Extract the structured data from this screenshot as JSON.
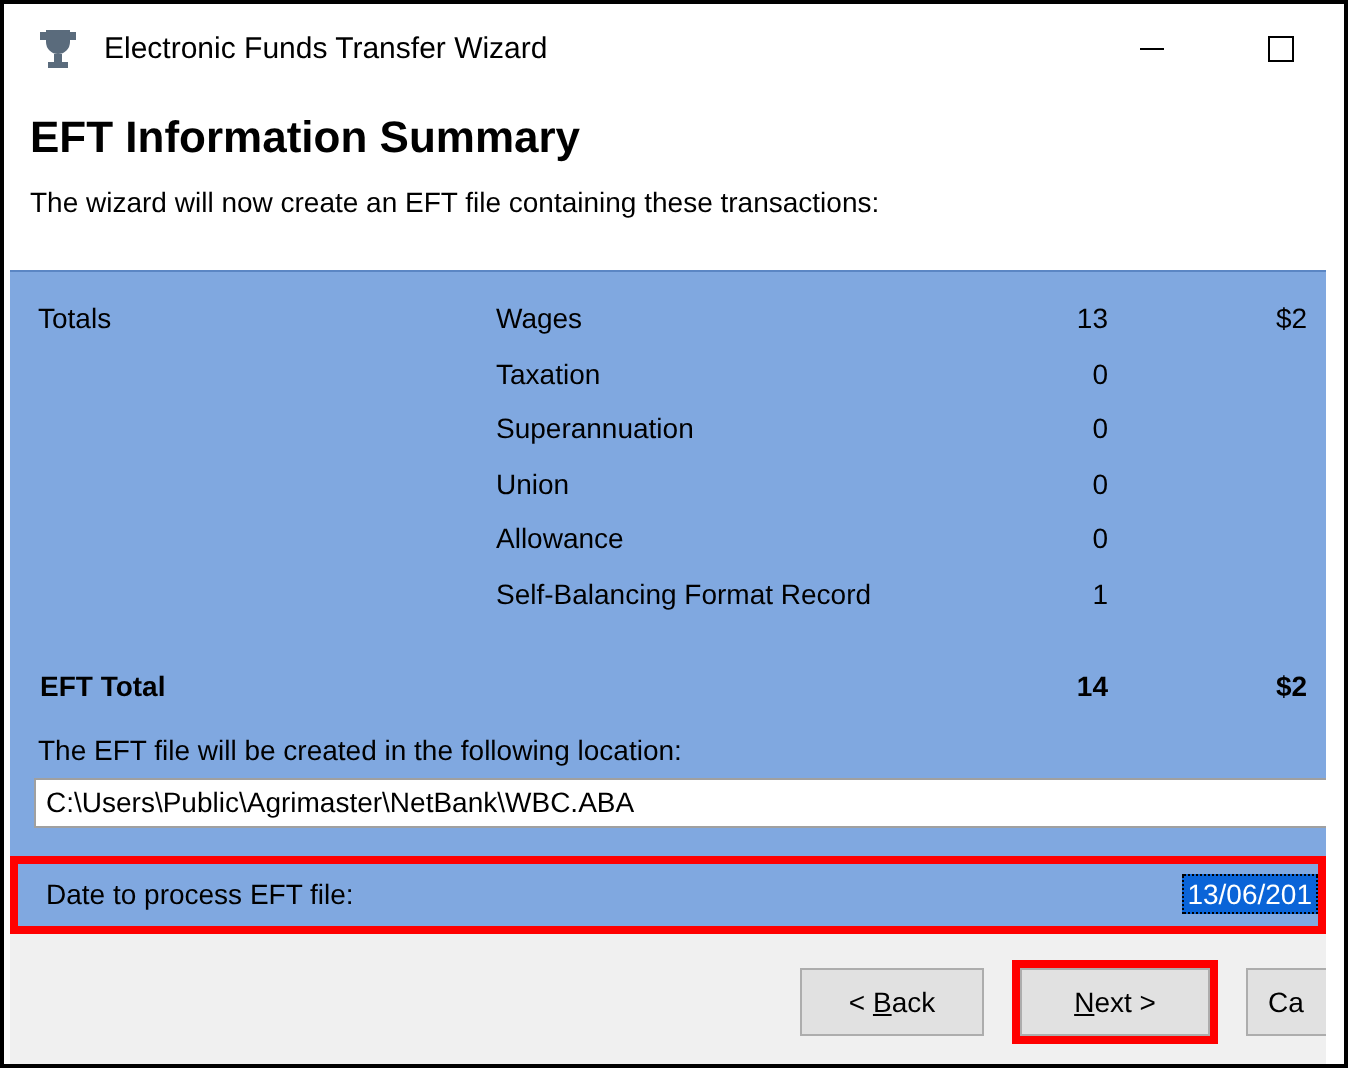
{
  "window": {
    "title": "Electronic Funds Transfer Wizard"
  },
  "heading": "EFT Information Summary",
  "subtitle": "The wizard will now create an EFT file containing these transactions:",
  "totals": {
    "label": "Totals",
    "rows": [
      {
        "category": "Wages",
        "count": "13",
        "amount": "$2"
      },
      {
        "category": "Taxation",
        "count": "0"
      },
      {
        "category": "Superannuation",
        "count": "0"
      },
      {
        "category": "Union",
        "count": "0"
      },
      {
        "category": "Allowance",
        "count": "0"
      },
      {
        "category": "Self-Balancing Format Record",
        "count": "1"
      }
    ]
  },
  "eft_total": {
    "label": "EFT Total",
    "count": "14",
    "amount": "$2"
  },
  "location": {
    "label": "The EFT file will be created in the following location:",
    "value": "C:\\Users\\Public\\Agrimaster\\NetBank\\WBC.ABA"
  },
  "date": {
    "label": "Date to process EFT file:",
    "value": "13/06/201",
    "text_selected": true,
    "highlighted": true
  },
  "buttons": [
    {
      "before": "< ",
      "mnemonic": "B",
      "after": "ack",
      "highlighted": false
    },
    {
      "mnemonic": "N",
      "after": "ext >",
      "highlighted": true
    },
    {
      "before": "Ca",
      "highlighted": false
    }
  ]
}
